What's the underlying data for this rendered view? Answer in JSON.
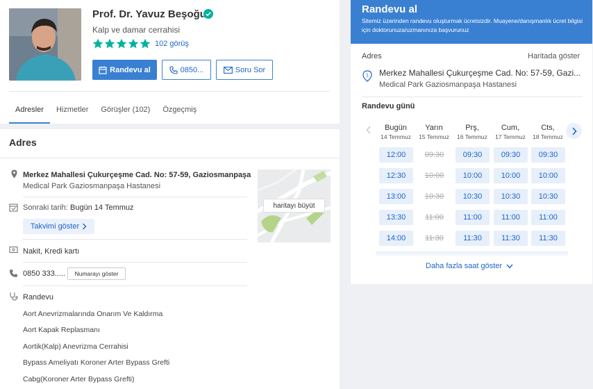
{
  "profile": {
    "name": "Prof. Dr. Yavuz Beşoğul",
    "specialty": "Kalp ve damar cerrahisi",
    "rating": 5,
    "review_count": "102 görüş",
    "buttons": {
      "randevu": "Randevu al",
      "phone": "0850...",
      "soru": "Soru Sor"
    },
    "tabs": [
      {
        "label": "Adresler",
        "active": true
      },
      {
        "label": "Hizmetler",
        "active": false
      },
      {
        "label": "Görüşler (102)",
        "active": false
      },
      {
        "label": "Özgeçmiş",
        "active": false
      }
    ]
  },
  "address_section": {
    "heading": "Adres",
    "street": "Merkez Mahallesi Çukurçeşme Cad. No: 57-59, Gaziosmanpaşa",
    "hospital": "Medical Park Gaziosmanpaşa Hastanesi",
    "next_date_label": "Sonraki tarih:",
    "next_date_value": "Bugün 14 Temmuz",
    "calendar_button": "Takvimi göster",
    "payment": "Nakit, Kredi kartı",
    "phone": "0850 333.....",
    "show_number_button": "Numarayı göster",
    "map_button": "haritayı büyüt",
    "services_label": "Randevu",
    "services": [
      "Aort Anevrizmalarında Onarım Ve Kaldırma",
      "Aort Kapak Replasmanı",
      "Aortik(Kalp) Anevrizma Cerrahisi",
      "Bypass Ameliyatı Koroner Arter Bypass Grefti",
      "Cabg(Koroner Arter Bypass Grefti)"
    ]
  },
  "booking": {
    "title": "Randevu al",
    "subtitle": "Sitemiz üzerinden randevu oluşturmak ücretsizdir. Muayene/danışmanlık ücret bilgisi için doktorunuza/uzmanınıza başvurunuz",
    "address_label": "Adres",
    "map_link": "Haritada göster",
    "address_line": "Merkez Mahallesi Çukurçeşme Cad. No: 57-59, Gazi...",
    "hospital": "Medical Park Gaziosmanpaşa Hastanesi",
    "day_label": "Randevu günü",
    "days": [
      {
        "name": "Bugün",
        "date": "14 Temmuz",
        "slots": [
          {
            "time": "12:00",
            "available": true
          },
          {
            "time": "12:30",
            "available": true
          },
          {
            "time": "13:00",
            "available": true
          },
          {
            "time": "13:30",
            "available": true
          },
          {
            "time": "14:00",
            "available": true
          }
        ]
      },
      {
        "name": "Yarın",
        "date": "15 Temmuz",
        "slots": [
          {
            "time": "09:30",
            "available": false
          },
          {
            "time": "10:00",
            "available": false
          },
          {
            "time": "10:30",
            "available": false
          },
          {
            "time": "11:00",
            "available": false
          },
          {
            "time": "11:30",
            "available": false
          }
        ]
      },
      {
        "name": "Prş,",
        "date": "16 Temmuz",
        "slots": [
          {
            "time": "09:30",
            "available": true
          },
          {
            "time": "10:00",
            "available": true
          },
          {
            "time": "10:30",
            "available": true
          },
          {
            "time": "11:00",
            "available": true
          },
          {
            "time": "11:30",
            "available": true
          }
        ]
      },
      {
        "name": "Cum,",
        "date": "17 Temmuz",
        "slots": [
          {
            "time": "09:30",
            "available": true
          },
          {
            "time": "10:00",
            "available": true
          },
          {
            "time": "10:30",
            "available": true
          },
          {
            "time": "11:00",
            "available": true
          },
          {
            "time": "11:30",
            "available": true
          }
        ]
      },
      {
        "name": "Cts,",
        "date": "18 Temmuz",
        "slots": [
          {
            "time": "09:30",
            "available": true
          },
          {
            "time": "10:00",
            "available": true
          },
          {
            "time": "10:30",
            "available": true
          },
          {
            "time": "11:00",
            "available": true
          },
          {
            "time": "11:30",
            "available": true
          }
        ]
      }
    ],
    "more_slots": "Daha fazla saat göster"
  },
  "colors": {
    "accent": "#3a80d2",
    "link": "#1f64c8",
    "star": "#00b39e",
    "slot_bg": "#e6effa"
  }
}
